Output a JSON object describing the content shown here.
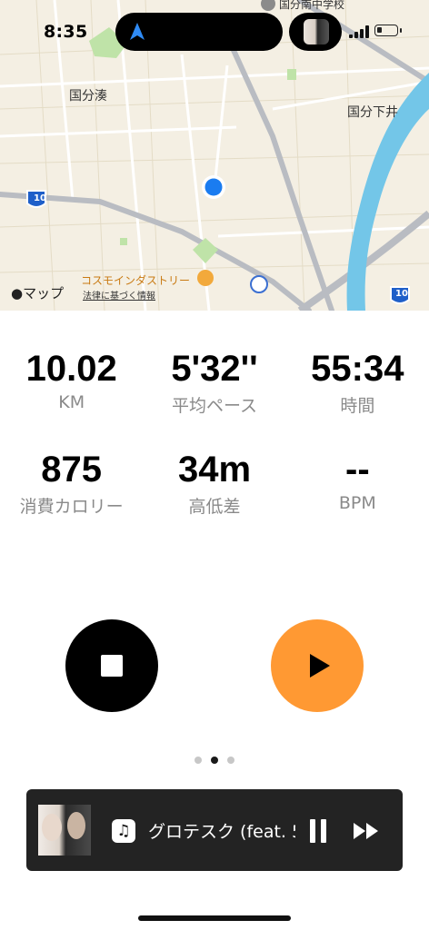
{
  "status_bar": {
    "time": "8:35"
  },
  "map": {
    "labels": {
      "kokubu_minato": "国分湊",
      "kokubu_shimoi": "国分下井",
      "school": "国分南中学校",
      "cosmo": "コスモインダストリー",
      "apple_maps": "マップ",
      "legal": "法律に基づく情報",
      "route_10": "10"
    }
  },
  "stats": {
    "distance": {
      "value": "10.02",
      "label": "KM"
    },
    "pace": {
      "value": "5'32''",
      "label": "平均ペース"
    },
    "duration": {
      "value": "55:34",
      "label": "時間"
    },
    "calories": {
      "value": "875",
      "label": "消費カロリー"
    },
    "elevation": {
      "value": "34m",
      "label": "高低差"
    },
    "heart_rate": {
      "value": "--",
      "label": "BPM"
    }
  },
  "controls": {
    "stop_color": "#000000",
    "resume_color": "#ff9933"
  },
  "pager": {
    "count": 3,
    "active": 1
  },
  "now_playing": {
    "title": "グロテスク (feat. 5"
  }
}
